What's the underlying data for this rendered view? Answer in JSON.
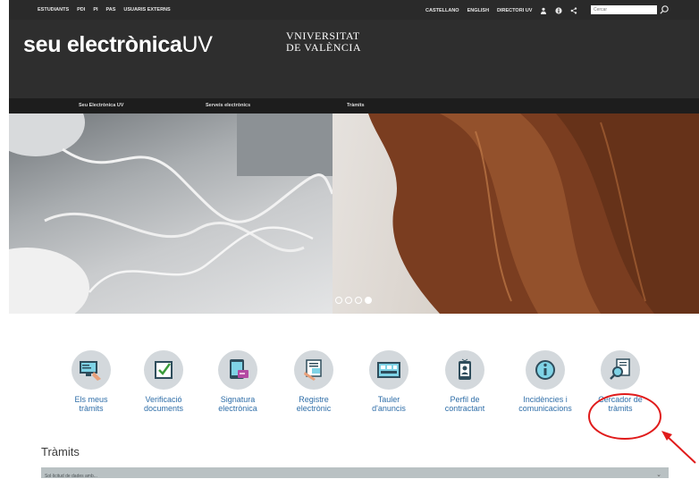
{
  "topbar": {
    "links_left": [
      "ESTUDIANTS",
      "PDI",
      "PI",
      "PAS",
      "USUARIS EXTERNS"
    ],
    "links_right": [
      "CASTELLANO",
      "ENGLISH",
      "DIRECTORI UV"
    ],
    "icons": [
      "user-icon",
      "info-icon",
      "share-icon"
    ],
    "search_placeholder": "Cercar"
  },
  "banner": {
    "logo_main": "seu electrònica",
    "logo_suffix": "UV",
    "university_line1": "VNIVERSITAT",
    "university_line2": "DE VALÈNCIA"
  },
  "mainnav": {
    "items": [
      "Seu Electrònica UV",
      "Serveis electrònics",
      "Tràmits"
    ]
  },
  "carousel": {
    "slides": 4,
    "active_index": 3
  },
  "services": [
    {
      "line1": "Els meus",
      "line2": "tràmits",
      "icon": "my-procedures-icon"
    },
    {
      "line1": "Verificació",
      "line2": "documents",
      "icon": "document-verification-icon"
    },
    {
      "line1": "Signatura",
      "line2": "electrònica",
      "icon": "electronic-signature-icon"
    },
    {
      "line1": "Registre",
      "line2": "electrònic",
      "icon": "electronic-register-icon"
    },
    {
      "line1": "Tauler",
      "line2": "d'anuncis",
      "icon": "notice-board-icon"
    },
    {
      "line1": "Perfil de",
      "line2": "contractant",
      "icon": "contractor-profile-icon"
    },
    {
      "line1": "Incidències i",
      "line2": "comunicacions",
      "icon": "info-circle-icon"
    },
    {
      "line1": "Cercador de",
      "line2": "tràmits",
      "icon": "procedure-search-icon"
    }
  ],
  "section": {
    "title": "Tràmits",
    "accordion_label": "Sol·licitud de dades amb..."
  },
  "colors": {
    "banner_bg": "#2e2e2e",
    "link_blue": "#2f6ea8",
    "icon_circle": "#d3d8dc",
    "annotation_red": "#e01b1b"
  }
}
